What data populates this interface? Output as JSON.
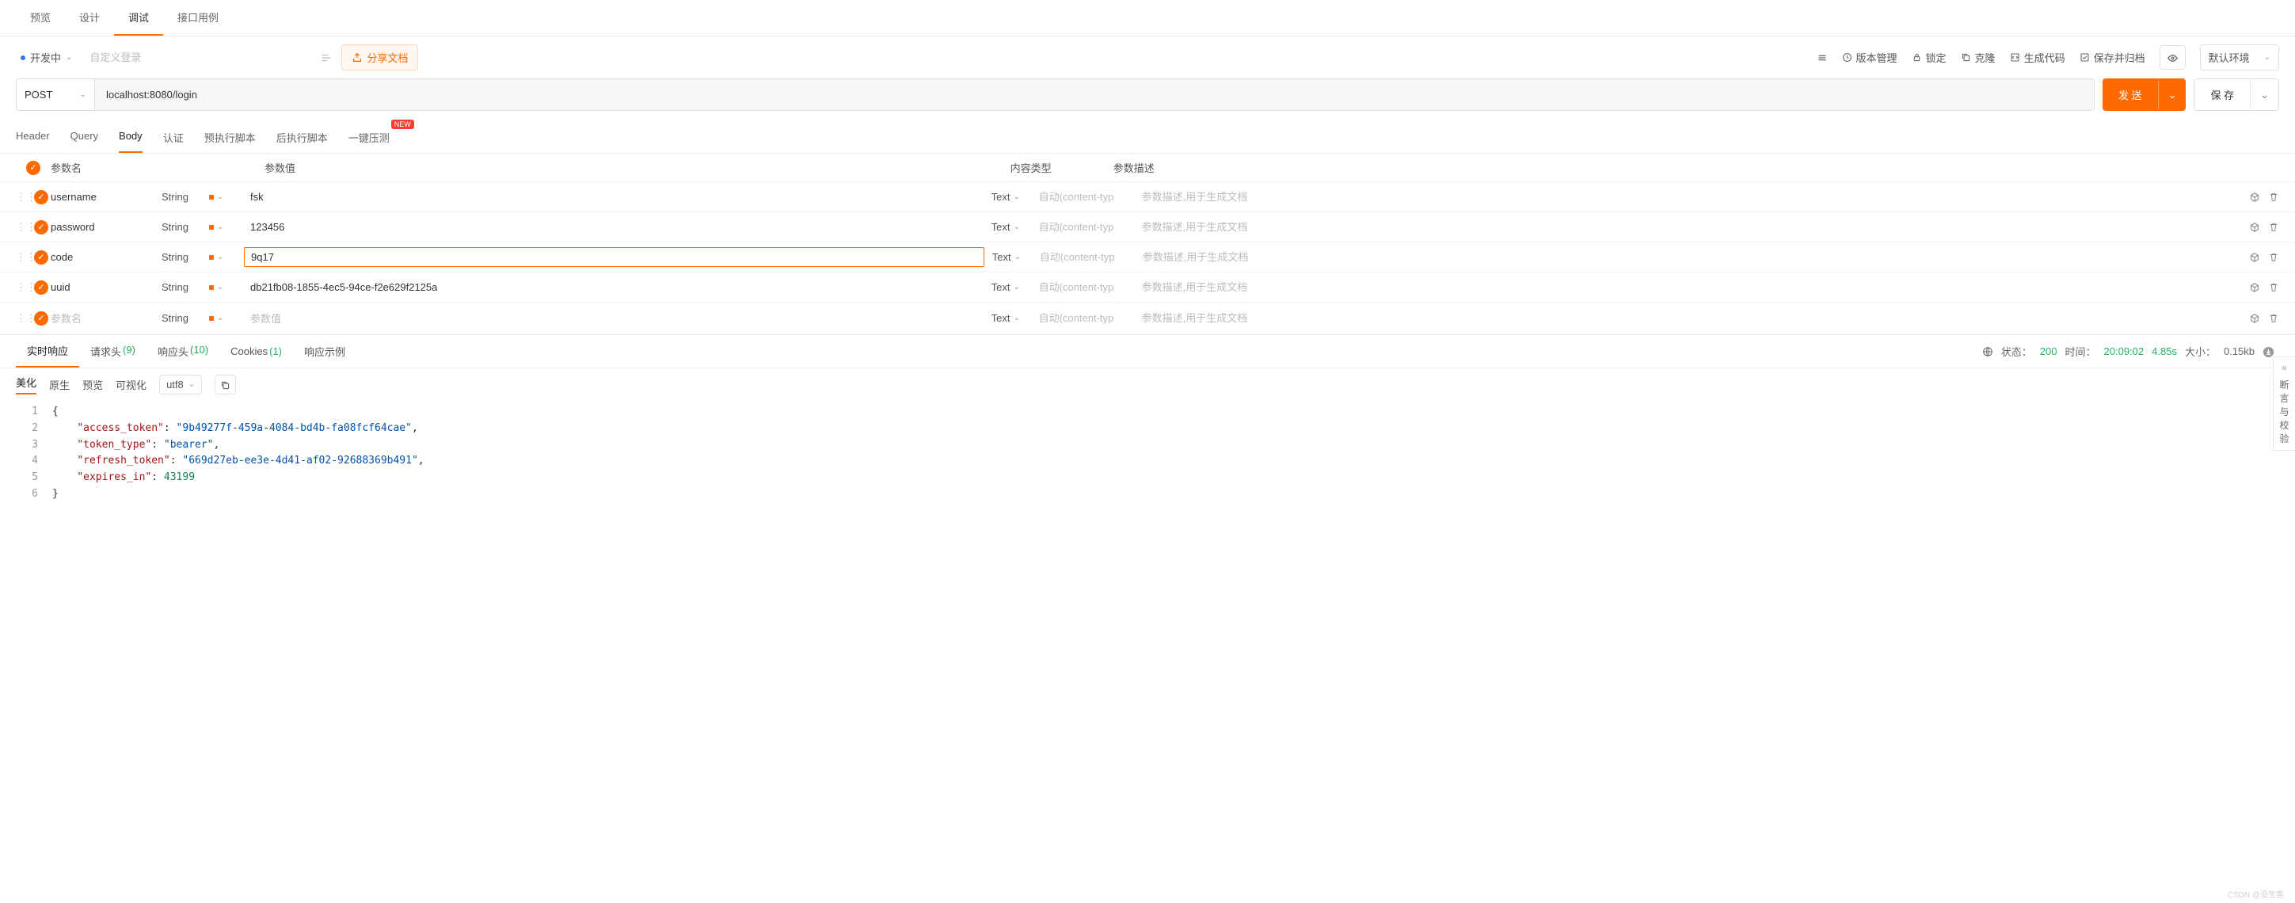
{
  "topTabs": [
    "预览",
    "设计",
    "调试",
    "接口用例"
  ],
  "topTabActive": 2,
  "status": {
    "label": "开发中"
  },
  "customNamePlaceholder": "自定义登录",
  "shareLabel": "分享文档",
  "headerActions": {
    "version": "版本管理",
    "lock": "锁定",
    "clone": "克隆",
    "codegen": "生成代码",
    "archive": "保存并归档"
  },
  "envLabel": "默认环境",
  "request": {
    "method": "POST",
    "url": "localhost:8080/login",
    "send": "发 送",
    "save": "保 存"
  },
  "subTabs": {
    "items": [
      "Header",
      "Query",
      "Body",
      "认证",
      "预执行脚本",
      "后执行脚本",
      "一键压测"
    ],
    "active": 2,
    "newBadge": "NEW"
  },
  "paramHead": {
    "name": "参数名",
    "value": "参数值",
    "ct": "内容类型",
    "desc": "参数描述"
  },
  "typeLabel": "String",
  "textLabel": "Text",
  "ctPlaceholder": "自动(content-typ",
  "descPlaceholder": "参数描述,用于生成文档",
  "namePlaceholder": "参数名",
  "valuePlaceholder": "参数值",
  "params": [
    {
      "name": "username",
      "value": "fsk",
      "active": false
    },
    {
      "name": "password",
      "value": "123456",
      "active": false
    },
    {
      "name": "code",
      "value": "9q17",
      "active": true
    },
    {
      "name": "uuid",
      "value": "db21fb08-1855-4ec5-94ce-f2e629f2125a",
      "active": false
    }
  ],
  "respTabs": {
    "realtime": "实时响应",
    "reqHead": "请求头",
    "reqHeadCount": 9,
    "respHead": "响应头",
    "respHeadCount": 10,
    "cookies": "Cookies",
    "cookiesCount": 1,
    "example": "响应示例"
  },
  "respStatus": {
    "stateLabel": "状态：",
    "code": 200,
    "timeLabel": "时间：",
    "time": "20:09:02",
    "dur": "4.85s",
    "sizeLabel": "大小：",
    "size": "0.15kb"
  },
  "fmt": {
    "beautify": "美化",
    "raw": "原生",
    "preview": "预览",
    "visual": "可视化",
    "enc": "utf8"
  },
  "responseBody": [
    {
      "k": "access_token",
      "v": "\"9b49277f-459a-4084-bd4b-fa08fcf64cae\"",
      "t": "str",
      "comma": true
    },
    {
      "k": "token_type",
      "v": "\"bearer\"",
      "t": "str",
      "comma": true
    },
    {
      "k": "refresh_token",
      "v": "\"669d27eb-ee3e-4d41-af02-92688369b491\"",
      "t": "str",
      "comma": true
    },
    {
      "k": "expires_in",
      "v": "43199",
      "t": "num",
      "comma": false
    }
  ],
  "rail": "断言与校验",
  "watermark": "CSDN @没生客"
}
